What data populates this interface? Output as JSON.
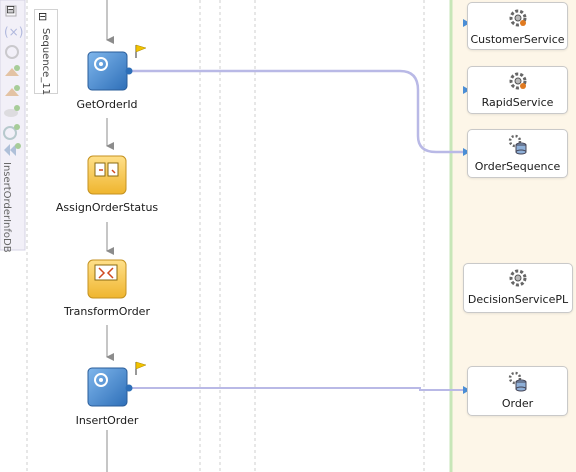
{
  "scope": {
    "name": "InsertOrderInfoDB",
    "collapse_symbol": "⊟"
  },
  "sequence": {
    "name": "Sequence_11",
    "collapse_symbol": "⊟"
  },
  "activities": [
    {
      "label": "GetOrderId",
      "icon": "invoke-gear-icon",
      "flag": true
    },
    {
      "label": "AssignOrderStatus",
      "icon": "assign-icon",
      "flag": false
    },
    {
      "label": "TransformOrder",
      "icon": "transform-icon",
      "flag": false
    },
    {
      "label": "InsertOrder",
      "icon": "invoke-gear-icon",
      "flag": true
    }
  ],
  "partner_links": [
    {
      "label": "CustomerService",
      "icon": "gear-service-icon"
    },
    {
      "label": "RapidService",
      "icon": "gear-service-icon"
    },
    {
      "label": "OrderSequence",
      "icon": "db-adapter-icon"
    },
    {
      "label": "DecisionServicePL",
      "icon": "gear-service-icon"
    },
    {
      "label": "Order",
      "icon": "db-adapter-icon"
    }
  ],
  "colors": {
    "invoke_blue": "#4a8ed6",
    "assign_yellow": "#f3c64a",
    "swimlane_bg": "#fdf6e8",
    "connector": "#b9b9e6",
    "flow_arrow": "#8c8c8c"
  }
}
